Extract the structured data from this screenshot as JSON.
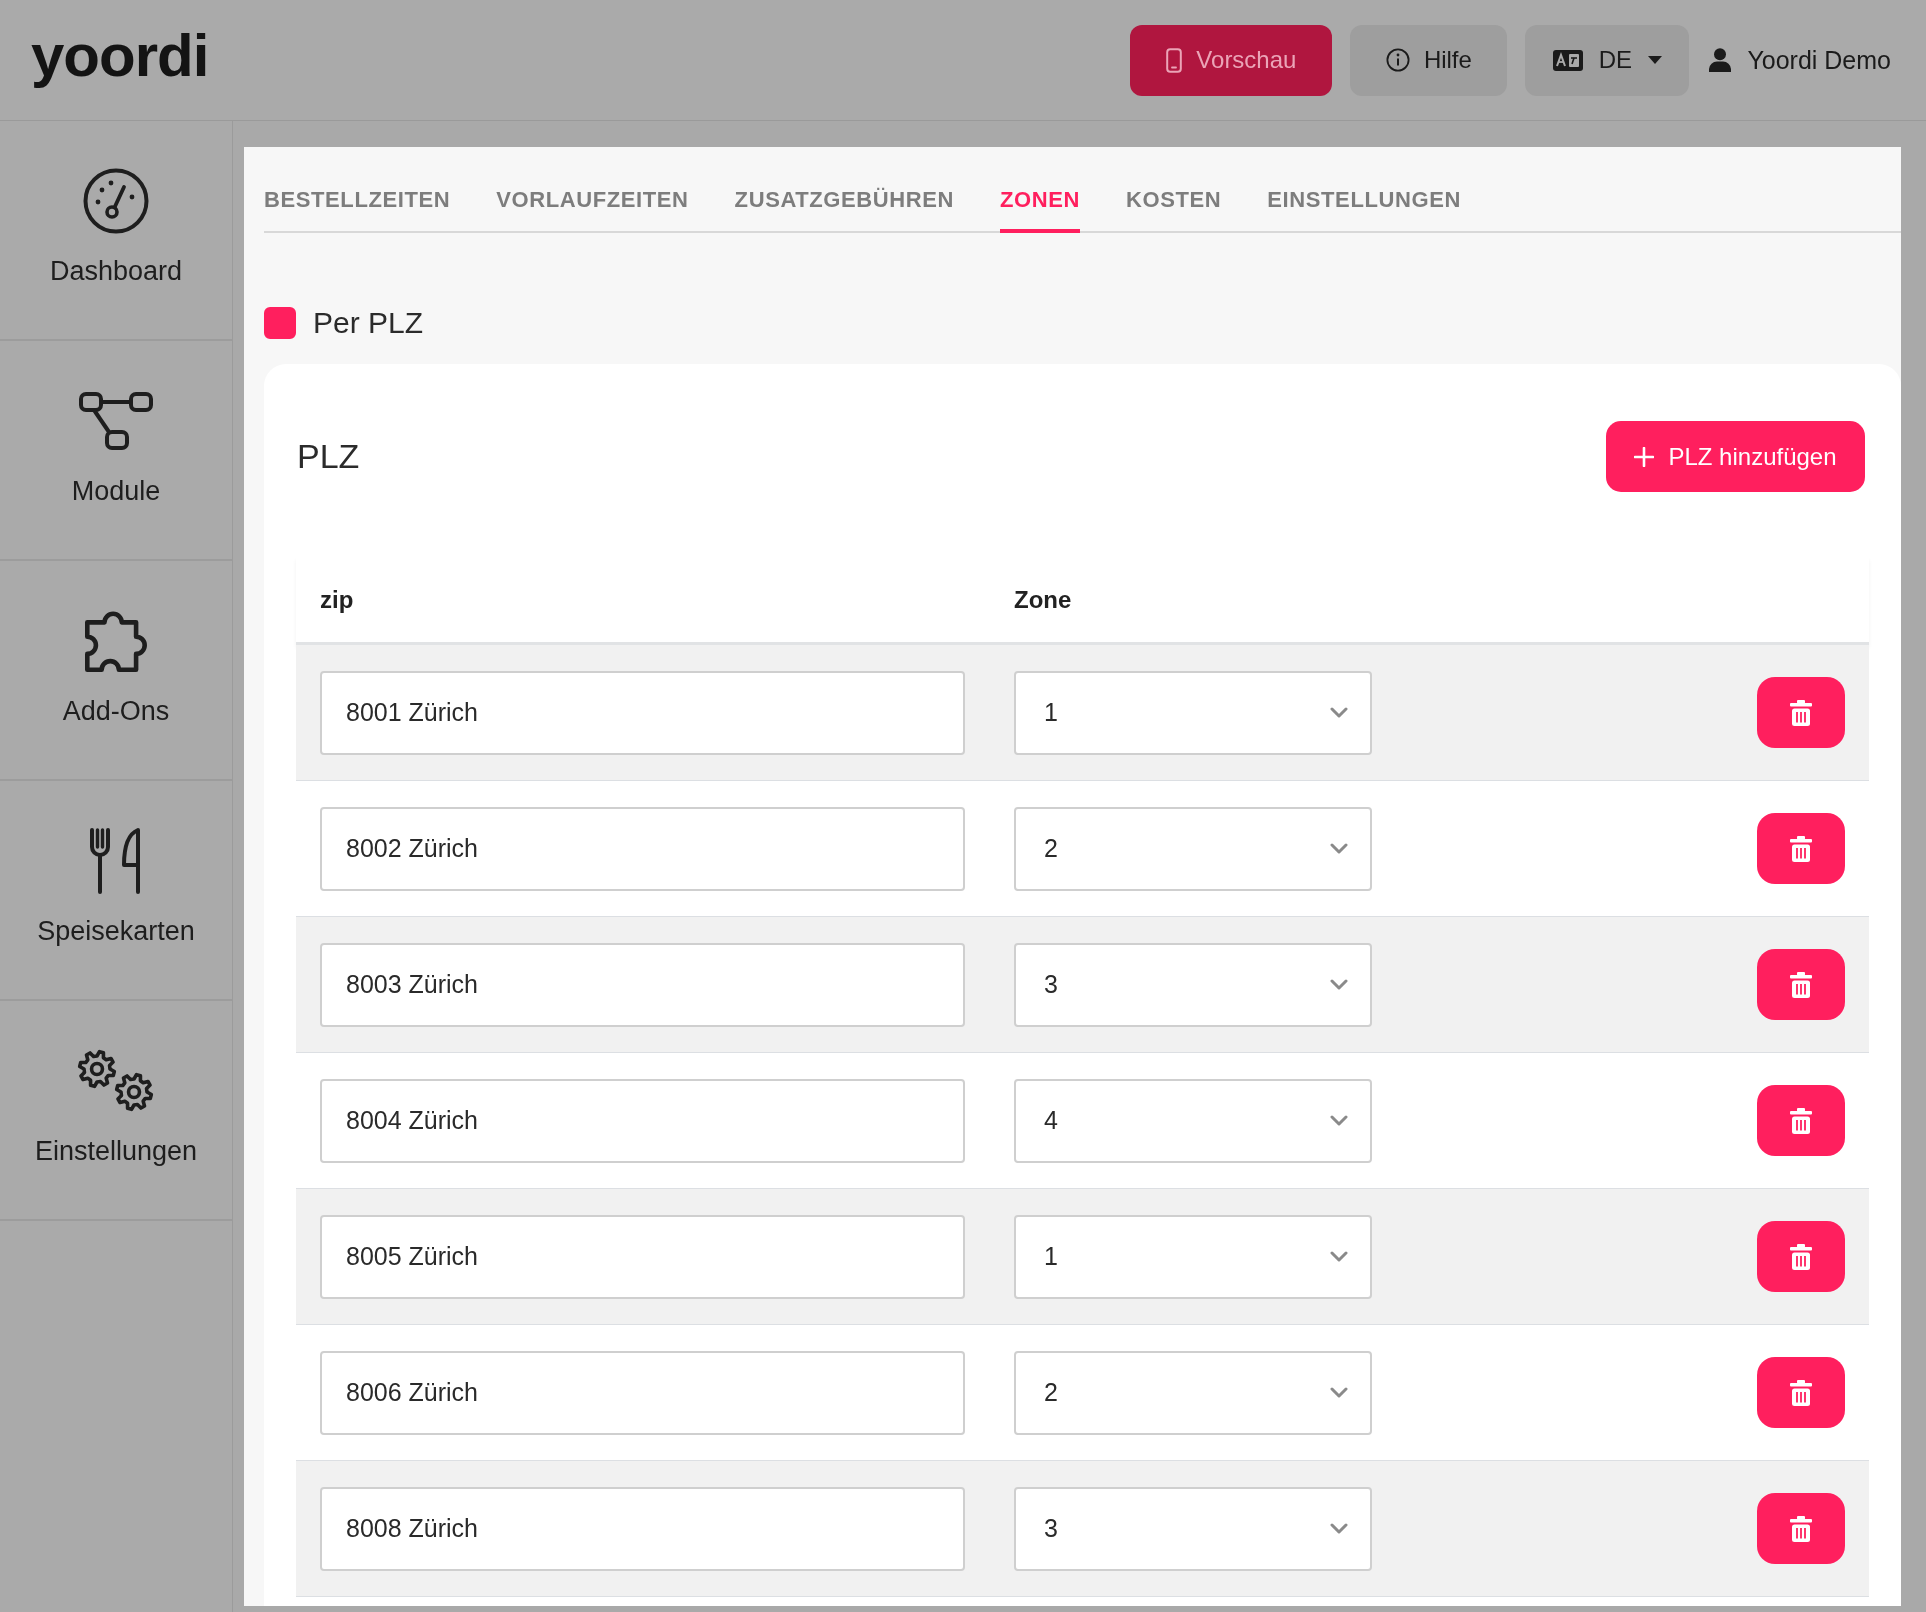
{
  "header": {
    "logo": "yoordi",
    "buttons": [
      {
        "kind": "preview",
        "label": "Vorschau"
      },
      {
        "kind": "help",
        "label": "Hilfe"
      },
      {
        "kind": "language",
        "label": "DE"
      }
    ],
    "user": "Yoordi Demo"
  },
  "sidebar": {
    "items": [
      {
        "label": "Dashboard",
        "selected": false
      },
      {
        "label": "Module",
        "selected": false
      },
      {
        "label": "Add-Ons",
        "selected": false
      },
      {
        "label": "Speisekarten",
        "selected": false
      },
      {
        "label": "Einstellungen",
        "selected": false
      }
    ]
  },
  "tabs": [
    {
      "label": "BESTELLZEITEN",
      "selected": false
    },
    {
      "label": "VORLAUFZEITEN",
      "selected": false
    },
    {
      "label": "ZUSATZGEBÜHREN",
      "selected": false
    },
    {
      "label": "ZONEN",
      "selected": true
    },
    {
      "label": "KOSTEN",
      "selected": false
    },
    {
      "label": "EINSTELLUNGEN",
      "selected": false
    }
  ],
  "per_plz": {
    "label": "Per PLZ",
    "checked": true
  },
  "plz_card": {
    "title": "PLZ",
    "add_button": "PLZ hinzufügen",
    "columns": [
      "zip",
      "Zone"
    ],
    "rows": [
      {
        "zip": "8001 Zürich",
        "zone": "1"
      },
      {
        "zip": "8002 Zürich",
        "zone": "2"
      },
      {
        "zip": "8003 Zürich",
        "zone": "3"
      },
      {
        "zip": "8004 Zürich",
        "zone": "4"
      },
      {
        "zip": "8005 Zürich",
        "zone": "1"
      },
      {
        "zip": "8006 Zürich",
        "zone": "2"
      },
      {
        "zip": "8008 Zürich",
        "zone": "3"
      }
    ]
  }
}
